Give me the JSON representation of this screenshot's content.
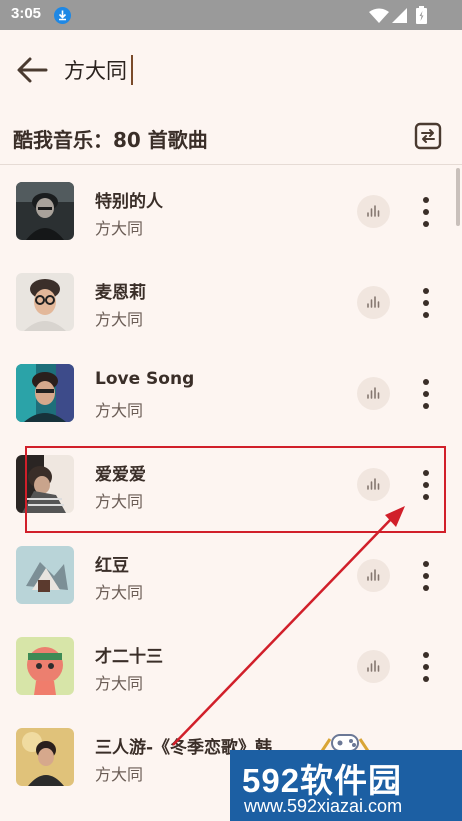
{
  "status": {
    "time": "3:05"
  },
  "search": {
    "query": "方大同"
  },
  "results": {
    "title": "酷我音乐：80 首歌曲"
  },
  "songs": [
    {
      "title": "特别的人",
      "artist": "方大同"
    },
    {
      "title": "麦恩莉",
      "artist": "方大同"
    },
    {
      "title": "Love Song",
      "artist": "方大同"
    },
    {
      "title": "爱爱爱",
      "artist": "方大同"
    },
    {
      "title": "红豆",
      "artist": "方大同"
    },
    {
      "title": "才二十三",
      "artist": "方大同"
    },
    {
      "title": "三人游-《冬季恋歌》韩",
      "artist": "方大同"
    }
  ],
  "watermark": {
    "brand": "592软件园",
    "url": "www.592xiazai.com"
  },
  "colors": {
    "accent": "#d11f2a",
    "background": "#fdf5f1",
    "watermark_bg": "#1c5fa3"
  }
}
